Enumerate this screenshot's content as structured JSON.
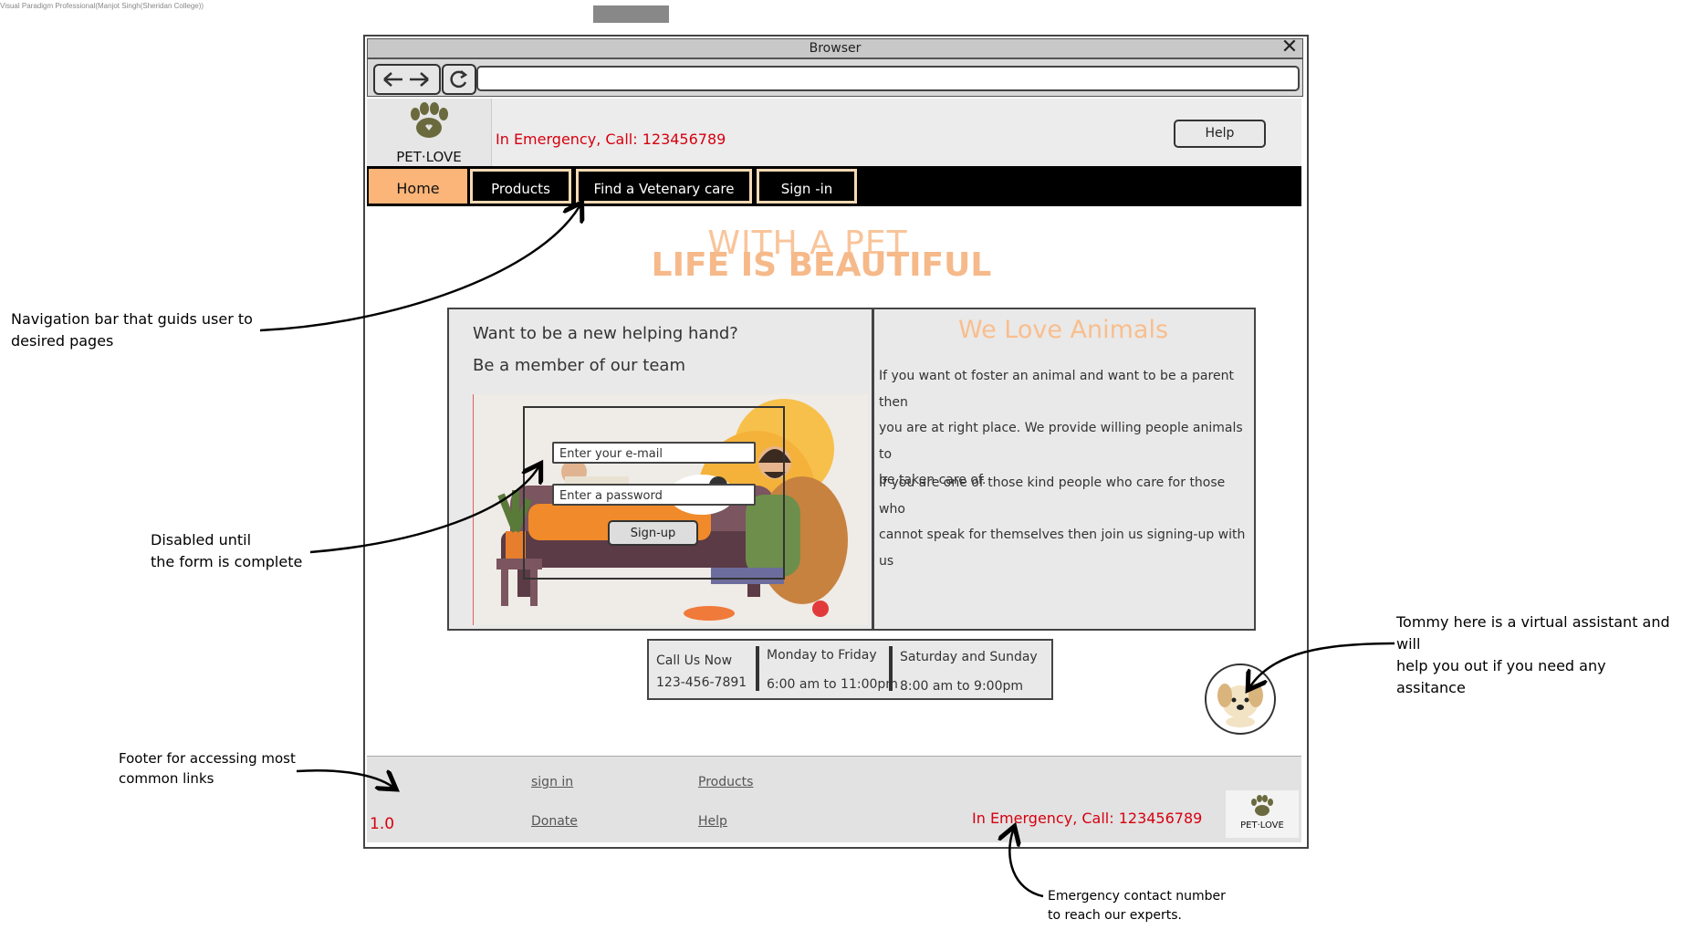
{
  "watermark": "Visual Paradigm Professional(Manjot Singh(Sheridan College))",
  "browser": {
    "title": "Browser",
    "address": ""
  },
  "site": {
    "brand": "PET·LOVE",
    "emergency": "In Emergency, Call: 123456789",
    "help_label": "Help",
    "nav": [
      {
        "label": "Home",
        "active": true
      },
      {
        "label": "Products",
        "active": false
      },
      {
        "label": "Find a Vetenary care",
        "active": false
      },
      {
        "label": "Sign -in",
        "active": false
      }
    ],
    "hero": {
      "line1": "WITH A PET",
      "line2": "LIFE IS BEAUTIFUL"
    }
  },
  "signup_panel": {
    "heading1": "Want to be a new helping hand?",
    "heading2": "Be a member of our team",
    "email_placeholder": "Enter your e-mail",
    "password_placeholder": "Enter a password",
    "signup_label": "Sign-up"
  },
  "about_panel": {
    "title": "We Love Animals",
    "para1": [
      "If you want ot foster an animal and want to be a parent then",
      "you are at right place. We provide willing people animals to",
      "be taken care of."
    ],
    "para2": [
      "If you are one of those kind people who care for those who",
      "cannot speak for themselves then join us signing-up with us"
    ]
  },
  "hours": {
    "call_label": "Call Us Now",
    "call_number": "123-456-7891",
    "weekday_label": "Monday to Friday",
    "weekday_hours": "6:00 am to 11:00pm",
    "weekend_label": "Saturday and Sunday",
    "weekend_hours": "8:00 am to 9:00pm"
  },
  "footer": {
    "links": [
      "sign in",
      "Products",
      "Donate",
      "Help"
    ],
    "version": "1.0",
    "emergency": "In Emergency, Call: 123456789",
    "brand": "PET·LOVE"
  },
  "annotations": {
    "nav": [
      "Navigation bar that guids user to",
      "desired pages"
    ],
    "disabled": [
      "Disabled until",
      "the form is complete"
    ],
    "assistant": [
      "Tommy here is a virtual assistant and will",
      "help you out if you need any",
      "assitance"
    ],
    "footer": [
      "Footer for accessing most",
      "common links"
    ],
    "emergency": [
      "Emergency contact number",
      "to reach our experts."
    ]
  },
  "colors": {
    "accent": "#fbb578",
    "hero": "#f6b98a",
    "emergency": "#d6000f",
    "nav_bg": "#000000"
  }
}
